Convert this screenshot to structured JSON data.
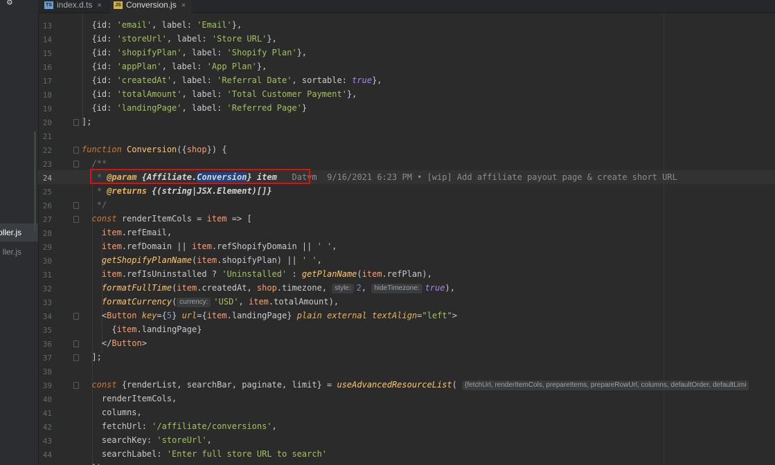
{
  "sidebar": {
    "items": [
      {
        "label": "oller.js",
        "active": true
      },
      {
        "label": "ller.js",
        "active": false
      }
    ]
  },
  "tabs": [
    {
      "icon": "TS",
      "label": "index.d.ts",
      "close": "×",
      "active": false
    },
    {
      "icon": "JS",
      "label": "Conversion.js",
      "close": "×",
      "active": true
    }
  ],
  "editor": {
    "line_numbers": [
      "13",
      "14",
      "15",
      "16",
      "17",
      "18",
      "19",
      "20",
      "21",
      "22",
      "23",
      "24",
      "25",
      "26",
      "27",
      "28",
      "29",
      "30",
      "31",
      "32",
      "33",
      "34",
      "35",
      "36",
      "37",
      "38",
      "39",
      "40",
      "41",
      "42",
      "43",
      "44"
    ],
    "current_line": "24",
    "blame": {
      "author": "Datvm",
      "text": "9/16/2021 6:23 PM • [wip] Add affiliate payout page & create short URL"
    },
    "hints": {
      "style": "style:",
      "hideTimezone": "hideTimezone:",
      "currency": "currency:",
      "resource_params": "{fetchUrl, renderItemCols, prepareItems, prepareRowUrl, columns, defaultOrder, defaultLimi"
    }
  },
  "colors": {
    "background": "#2b2b2b",
    "keyword": "#cc7832",
    "function": "#ffc66d",
    "string": "#a5c25c",
    "highlight_box": "#e01010"
  }
}
